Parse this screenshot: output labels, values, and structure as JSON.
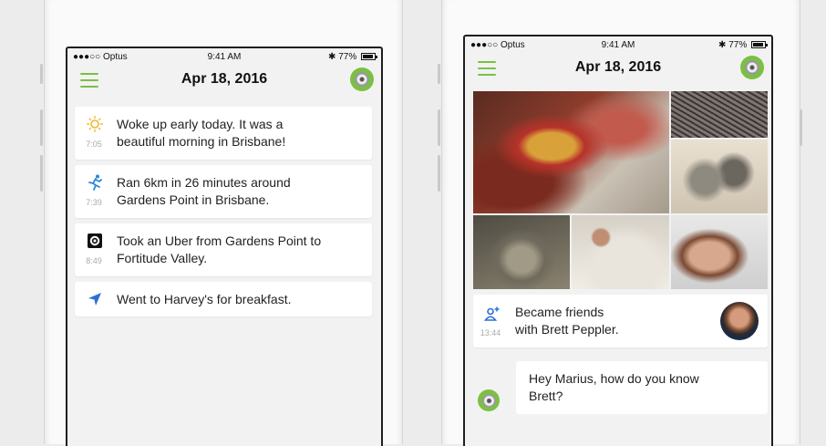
{
  "colors": {
    "accent": "#7bc043",
    "background": "#f2f2f2"
  },
  "left_phone": {
    "status": {
      "carrier": "●●●○○ Optus",
      "time": "9:41 AM",
      "battery": "77%"
    },
    "nav": {
      "title": "Apr 18, 2016"
    },
    "timeline": [
      {
        "icon": "sun-icon",
        "time": "7:05",
        "line1": "Woke up early today. It was a",
        "line2": "beautiful morning in Brisbane!"
      },
      {
        "icon": "runner-icon",
        "time": "7:39",
        "line1": "Ran 6km in 26 minutes around",
        "line2": "Gardens Point in Brisbane."
      },
      {
        "icon": "uber-icon",
        "time": "8:49",
        "line1": "Took an Uber from Gardens Point to",
        "line2": "Fortitude Valley."
      },
      {
        "icon": "location-arrow-icon",
        "time": "",
        "line1": "Went to Harvey's for breakfast.",
        "line2": ""
      }
    ]
  },
  "right_phone": {
    "status": {
      "carrier": "●●●○○ Optus",
      "time": "9:41 AM",
      "battery": "77%"
    },
    "nav": {
      "title": "Apr 18, 2016"
    },
    "friend_event": {
      "icon": "add-friend-icon",
      "time": "13:44",
      "line1": "Became friends",
      "line2": "with Brett Peppler."
    },
    "message": {
      "line1": "Hey Marius, how do you know",
      "line2": "Brett?"
    }
  }
}
